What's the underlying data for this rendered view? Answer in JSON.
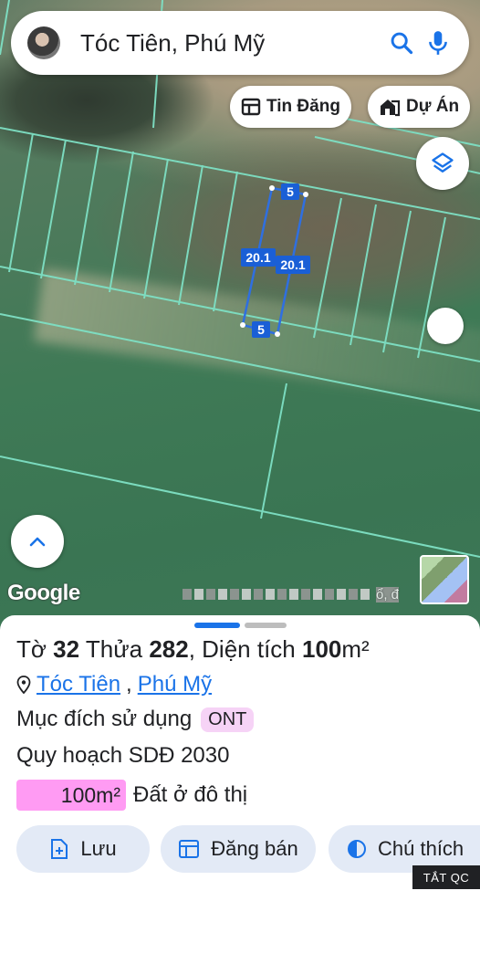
{
  "search": {
    "query": "Tóc Tiên, Phú Mỹ"
  },
  "chips": {
    "listings": "Tin Đăng",
    "projects": "Dự Án"
  },
  "map": {
    "google_label": "Google",
    "attribution_suffix": "ổ, đ",
    "parcel": {
      "top_width": "5",
      "bottom_width": "5",
      "left_length": "20.1",
      "right_length": "20.1"
    }
  },
  "sheet": {
    "to_label": "Tờ",
    "to_number": "32",
    "thua_label": "Thửa",
    "thua_number": "282",
    "area_label": ", Diện tích",
    "area_value": "100",
    "area_unit": "m²",
    "locality": "Tóc Tiên",
    "district": "Phú Mỹ",
    "purpose_label": "Mục đích sử dụng",
    "purpose_code": "ONT",
    "plan_label": "Quy hoạch SDĐ 2030",
    "land_area": "100m²",
    "land_type": "Đất ở đô thị"
  },
  "actions": {
    "save": "Lưu",
    "sell": "Đăng bán",
    "legend": "Chú thích"
  },
  "ad": {
    "label": "TẮT QC"
  },
  "colors": {
    "accent": "#1a73e8",
    "parcel_line": "#7ee0c4",
    "land_badge": "#ff9bf3",
    "ont_badge": "#f6d3f6"
  }
}
